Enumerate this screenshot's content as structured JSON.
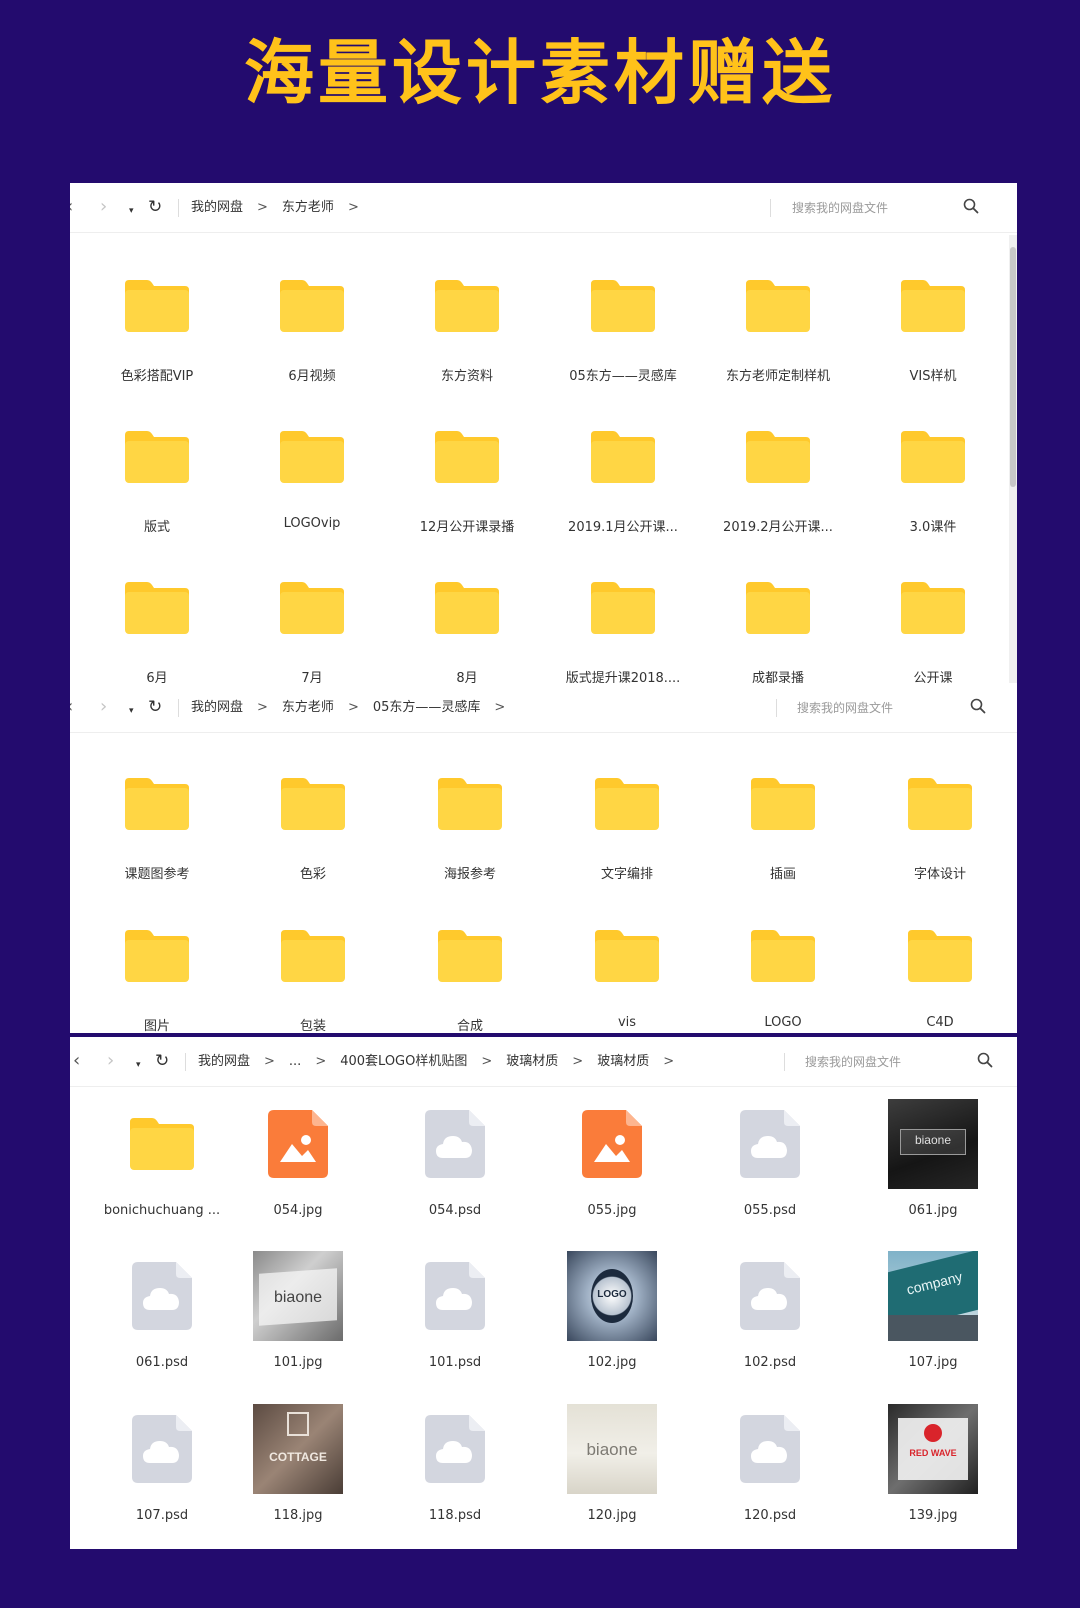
{
  "headline": "海量设计素材赠送",
  "nav": {
    "back": "‹",
    "forward": "›",
    "dropdown": "▾",
    "refresh": "↻"
  },
  "search_placeholder": "搜索我的网盘文件",
  "windows": [
    {
      "breadcrumbs": [
        "我的网盘",
        "东方老师"
      ],
      "items": [
        {
          "name": "色彩搭配VIP",
          "type": "folder"
        },
        {
          "name": "6月视频",
          "type": "folder"
        },
        {
          "name": "东方资料",
          "type": "folder"
        },
        {
          "name": "05东方——灵感库",
          "type": "folder"
        },
        {
          "name": "东方老师定制样机",
          "type": "folder"
        },
        {
          "name": "VIS样机",
          "type": "folder"
        },
        {
          "name": "版式",
          "type": "folder"
        },
        {
          "name": "LOGOvip",
          "type": "folder"
        },
        {
          "name": "12月公开课录播",
          "type": "folder"
        },
        {
          "name": "2019.1月公开课...",
          "type": "folder"
        },
        {
          "name": "2019.2月公开课...",
          "type": "folder"
        },
        {
          "name": "3.0课件",
          "type": "folder"
        },
        {
          "name": "6月",
          "type": "folder"
        },
        {
          "name": "7月",
          "type": "folder"
        },
        {
          "name": "8月",
          "type": "folder"
        },
        {
          "name": "版式提升课2018....",
          "type": "folder"
        },
        {
          "name": "成都录播",
          "type": "folder"
        },
        {
          "name": "公开课",
          "type": "folder"
        }
      ]
    },
    {
      "breadcrumbs": [
        "我的网盘",
        "东方老师",
        "05东方——灵感库"
      ],
      "items": [
        {
          "name": "课题图参考",
          "type": "folder"
        },
        {
          "name": "色彩",
          "type": "folder"
        },
        {
          "name": "海报参考",
          "type": "folder"
        },
        {
          "name": "文字编排",
          "type": "folder"
        },
        {
          "name": "插画",
          "type": "folder"
        },
        {
          "name": "字体设计",
          "type": "folder"
        },
        {
          "name": "图片",
          "type": "folder"
        },
        {
          "name": "包装",
          "type": "folder"
        },
        {
          "name": "合成",
          "type": "folder"
        },
        {
          "name": "vis",
          "type": "folder"
        },
        {
          "name": "LOGO",
          "type": "folder"
        },
        {
          "name": "C4D",
          "type": "folder"
        }
      ]
    },
    {
      "breadcrumbs": [
        "我的网盘",
        "...",
        "400套LOGO样机贴图",
        "玻璃材质",
        "玻璃材质"
      ],
      "items": [
        {
          "name": "bonichuchuang ...",
          "type": "folder"
        },
        {
          "name": "054.jpg",
          "type": "image"
        },
        {
          "name": "054.psd",
          "type": "psd"
        },
        {
          "name": "055.jpg",
          "type": "image"
        },
        {
          "name": "055.psd",
          "type": "psd"
        },
        {
          "name": "061.jpg",
          "type": "photo",
          "art": "dark",
          "text": "biaone"
        },
        {
          "name": "061.psd",
          "type": "psd"
        },
        {
          "name": "101.jpg",
          "type": "photo",
          "art": "stone",
          "text": "biaone"
        },
        {
          "name": "101.psd",
          "type": "psd"
        },
        {
          "name": "102.jpg",
          "type": "photo",
          "art": "badge",
          "text": "LOGO"
        },
        {
          "name": "102.psd",
          "type": "psd"
        },
        {
          "name": "107.jpg",
          "type": "photo",
          "art": "building",
          "text": "company"
        },
        {
          "name": "107.psd",
          "type": "psd"
        },
        {
          "name": "118.jpg",
          "type": "photo",
          "art": "cottage",
          "text": "COTTAGE"
        },
        {
          "name": "118.psd",
          "type": "psd"
        },
        {
          "name": "120.jpg",
          "type": "photo",
          "art": "wall",
          "text": "biaone"
        },
        {
          "name": "120.psd",
          "type": "psd"
        },
        {
          "name": "139.jpg",
          "type": "photo",
          "art": "redwave",
          "text": "RED WAVE"
        }
      ]
    }
  ],
  "colors": {
    "background": "#230b6e",
    "headline": "#ffc21a",
    "folder": "#ffd644",
    "folder_tab": "#ffc92c",
    "image_file": "#fa7c3a",
    "psd_file": "#d3d6df"
  }
}
